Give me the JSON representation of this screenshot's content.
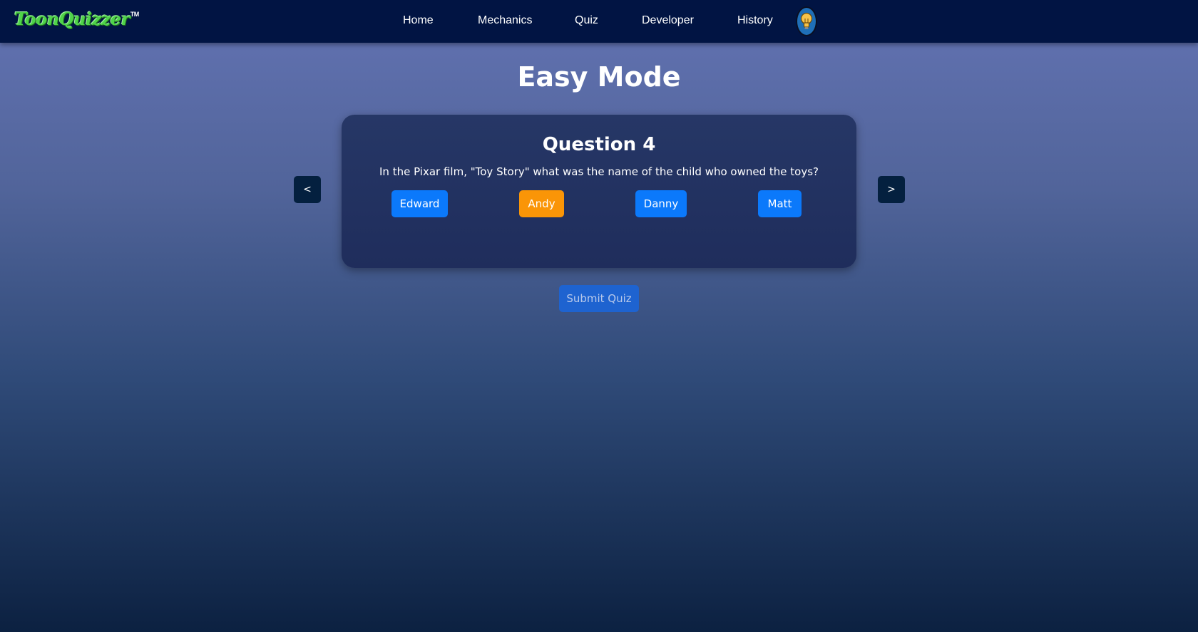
{
  "brand": {
    "logo_text": "ToonQuizzer",
    "trademark": "TM",
    "logo_color": "#4fd34a"
  },
  "nav": {
    "items": [
      {
        "label": "Home"
      },
      {
        "label": "Mechanics"
      },
      {
        "label": "Quiz"
      },
      {
        "label": "Developer"
      },
      {
        "label": "History"
      }
    ],
    "theme_toggle_icon": "lightbulb-icon"
  },
  "page": {
    "title": "Easy Mode"
  },
  "question": {
    "heading": "Question 4",
    "text": "In the Pixar film, \"Toy Story\" what was the name of the child who owned the toys?",
    "answers": [
      {
        "label": "Edward",
        "selected": false
      },
      {
        "label": "Andy",
        "selected": true
      },
      {
        "label": "Danny",
        "selected": false
      },
      {
        "label": "Matt",
        "selected": false
      }
    ]
  },
  "controls": {
    "prev_label": "<",
    "next_label": ">",
    "submit_label": "Submit Quiz"
  },
  "colors": {
    "navbar": "#011443",
    "answer_default": "#0b79fb",
    "answer_selected": "#fa9507",
    "submit": "#1e63d0",
    "arrow_button": "#04203f"
  }
}
